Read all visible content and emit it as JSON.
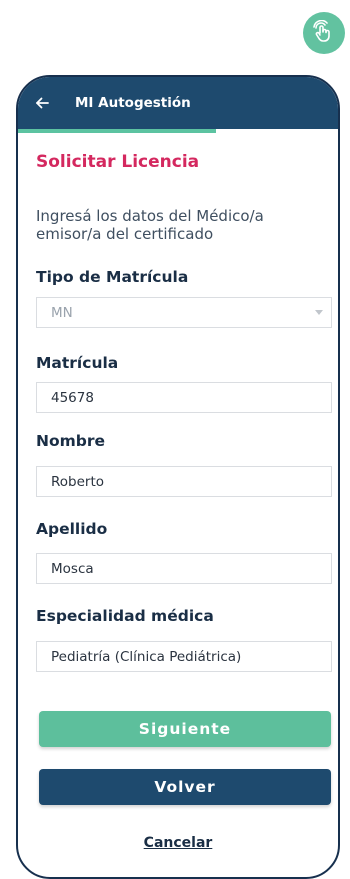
{
  "header": {
    "title": "MI Autogestión"
  },
  "form": {
    "title": "Solicitar Licencia",
    "intro": "Ingresá los datos del Médico/a emisor/a del certificado",
    "fields": {
      "tipo_matricula": {
        "label": "Tipo de Matrícula",
        "value": "MN"
      },
      "matricula": {
        "label": "Matrícula",
        "value": "45678"
      },
      "nombre": {
        "label": "Nombre",
        "value": "Roberto"
      },
      "apellido": {
        "label": "Apellido",
        "value": "Mosca"
      },
      "especialidad": {
        "label": "Especialidad médica",
        "value": "Pediatría (Clínica Pediátrica)"
      }
    }
  },
  "actions": {
    "next_label": "Siguiente",
    "back_label": "Volver",
    "cancel_label": "Cancelar"
  },
  "progress": 0.62,
  "icons": {
    "badge": "tap-gesture-icon",
    "back": "arrow-left-icon"
  },
  "colors": {
    "brand_dark": "#1e4a6e",
    "accent_green": "#5dbf9c",
    "title_pink": "#d4285f"
  }
}
